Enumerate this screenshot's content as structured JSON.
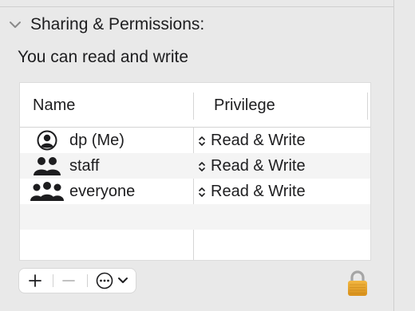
{
  "section": {
    "title": "Sharing & Permissions:",
    "disclosure_icon": "chevron-down-icon",
    "access_text": "You can read and write"
  },
  "table": {
    "columns": [
      "Name",
      "Privilege"
    ],
    "rows": [
      {
        "name": "dp (Me)",
        "icon": "user-circle-icon",
        "privilege": "Read & Write"
      },
      {
        "name": "staff",
        "icon": "group-icon",
        "privilege": "Read & Write"
      },
      {
        "name": "everyone",
        "icon": "everyone-icon",
        "privilege": "Read & Write"
      }
    ]
  },
  "toolbar": {
    "add_icon": "plus-icon",
    "remove_icon": "minus-icon",
    "action_icon": "ellipsis-circle-icon",
    "action_menu_icon": "chevron-down-icon"
  },
  "lock": {
    "icon": "lock-icon",
    "state": "locked",
    "color": "#e9a526"
  },
  "colors": {
    "background": "#e9e9e9",
    "table_background": "#ffffff",
    "alt_row": "#f4f4f4"
  }
}
